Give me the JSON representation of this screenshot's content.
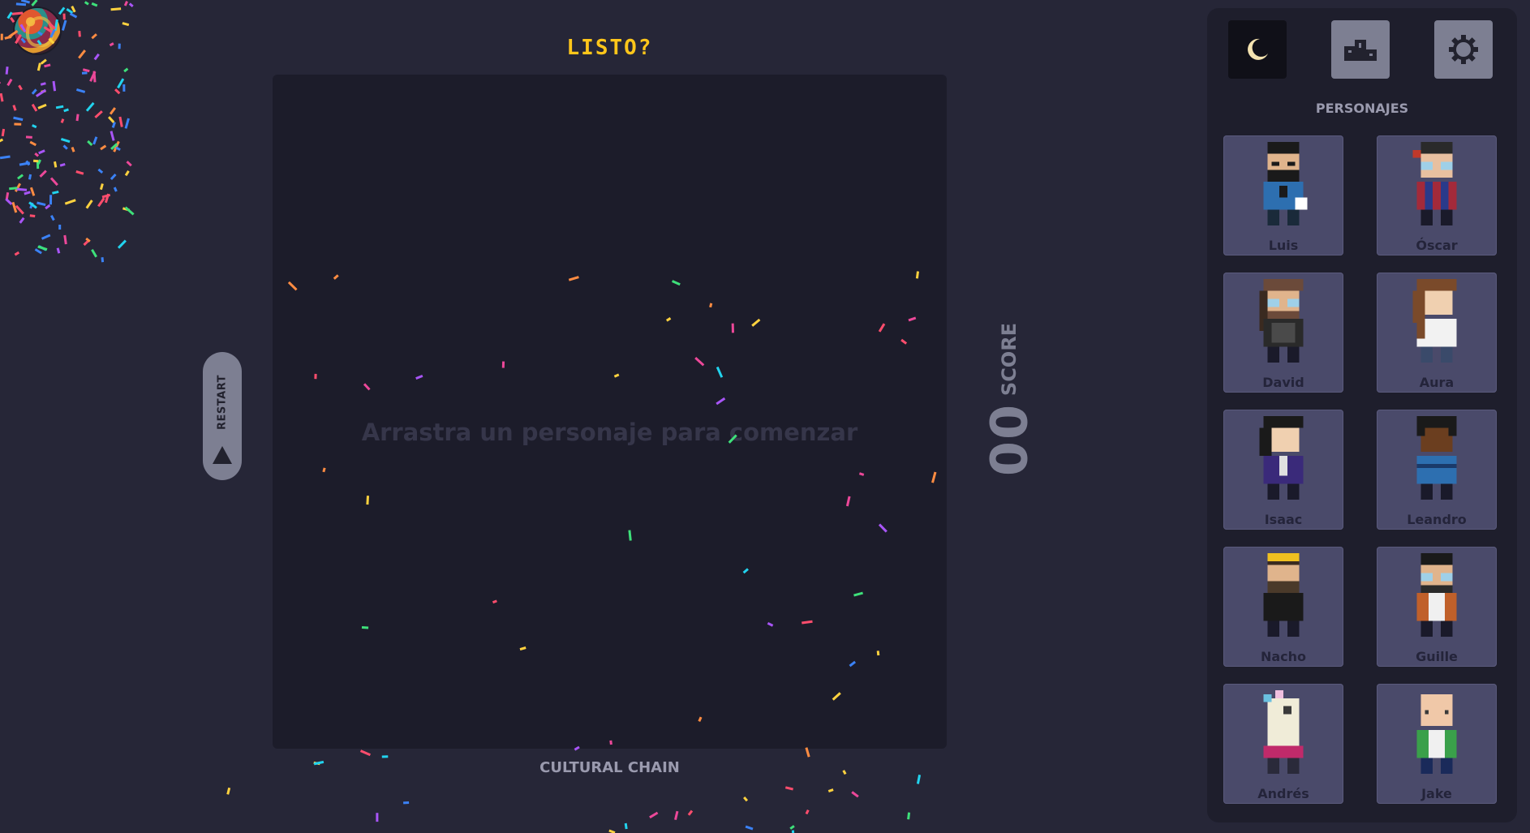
{
  "header": {
    "title": "LISTO?"
  },
  "restart": {
    "label": "RESTART",
    "icon": "triangle-up-icon"
  },
  "board": {
    "hint": "Arrastra un personaje para comenzar"
  },
  "footer": {
    "label": "CULTURAL CHAIN"
  },
  "score": {
    "label": "SCORE",
    "value": "00"
  },
  "toolbar": {
    "theme_icon": "moon-icon",
    "leaderboard_icon": "podium-icon",
    "settings_icon": "gear-icon"
  },
  "characters": {
    "title": "PERSONAJES",
    "items": [
      {
        "name": "Luis"
      },
      {
        "name": "Óscar"
      },
      {
        "name": "David"
      },
      {
        "name": "Aura"
      },
      {
        "name": "Isaac"
      },
      {
        "name": "Leandro"
      },
      {
        "name": "Nacho"
      },
      {
        "name": "Guille"
      },
      {
        "name": "Andrés"
      },
      {
        "name": "Jake"
      }
    ]
  },
  "colors": {
    "background": "#262637",
    "board": "#1c1c2a",
    "panel": "#1e1e2c",
    "card": "#4a4a6a",
    "accent_title": "#ffc61a",
    "muted": "#7d7f92"
  }
}
